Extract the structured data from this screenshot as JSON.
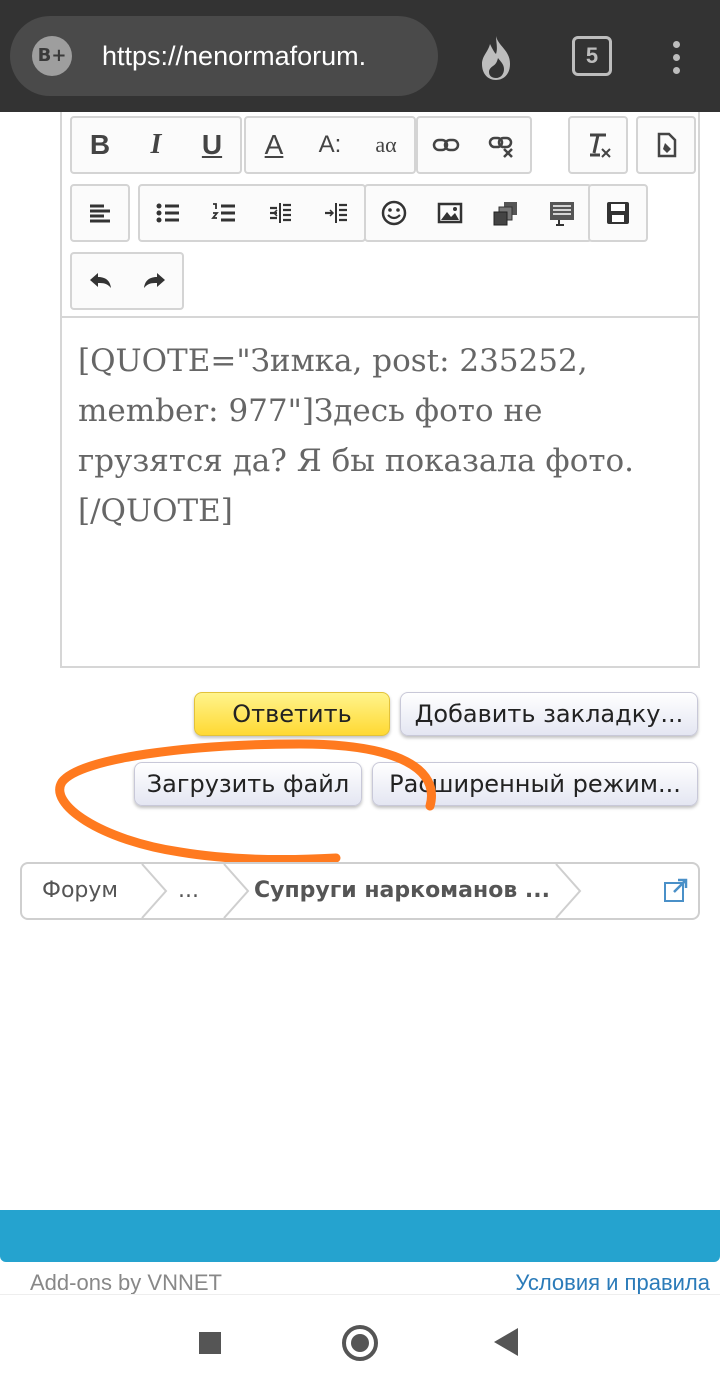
{
  "browser": {
    "site_badge": "B+",
    "url": "https://nenormaforum.",
    "tab_count": "5"
  },
  "toolbar": {
    "row1": [
      "bold-icon",
      "italic-icon",
      "underline-icon",
      "font-color-icon",
      "font-size-icon",
      "font-family-icon",
      "link-icon",
      "unlink-icon",
      "remove-format-icon",
      "toggle-bbcode-icon"
    ],
    "row2": [
      "align-icon",
      "bullet-list-icon",
      "numbered-list-icon",
      "outdent-icon",
      "indent-icon",
      "smilies-icon",
      "image-icon",
      "media-icon",
      "quote-icon",
      "save-draft-icon"
    ],
    "row3": [
      "undo-icon",
      "redo-icon"
    ],
    "labels": {
      "bold": "B",
      "italic": "I",
      "underline": "U",
      "font_color": "A",
      "font_size": "A:",
      "font_family": "aα"
    }
  },
  "editor": {
    "text": "[QUOTE=\"Зимка, post: 235252, member: 977\"]Здесь фото не грузятся да? Я бы показала фото.[/QUOTE]"
  },
  "actions": {
    "reply": "Ответить",
    "bookmark": "Добавить закладку...",
    "upload": "Загрузить файл",
    "advanced": "Расширенный режим..."
  },
  "breadcrumb": {
    "items": [
      "Форум",
      "...",
      "Супруги наркоманов ..."
    ]
  },
  "footer": {
    "left": "Add-ons by VNNET",
    "right": "Условия и правила"
  },
  "colors": {
    "annotation": "#ff7a1f",
    "footer_bar": "#25a3cf",
    "link": "#2b7bb9"
  }
}
